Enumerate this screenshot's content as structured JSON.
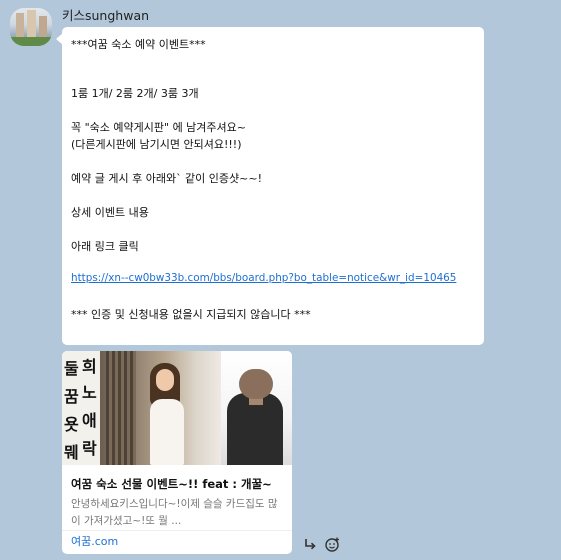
{
  "message": {
    "sender": "키스sunghwan",
    "lines": [
      "***여꿈 숙소 예약 이벤트***",
      "1룸 1개/ 2룸 2개/ 3룸 3개",
      "꼭  \"숙소 예약게시판\" 에 남겨주셔요~",
      "(다른게시판에 남기시면 안되셔요!!!)",
      "예약 글 게시 후 아래와` 같이 인증샷~~!",
      "상세 이벤트 내용",
      "아래 링크 클릭",
      "https://xn--cw0bw33b.com/bbs/board.php?bo_table=notice&wr_id=10465",
      "*** 인증 및 신청내용 없을시 지급되지 않습니다 ***"
    ]
  },
  "link_preview": {
    "calligraphy_left": [
      "둘",
      "꿈",
      "욧",
      "뭬"
    ],
    "calligraphy_right": [
      "희",
      "노",
      "애",
      "락"
    ],
    "title": "여꿈 숙소 선물 이벤트~!! feat : 개꿀~",
    "description": "안녕하세요키스입니다~!이제 슬슬 카드집도 많이 가져가셨고~!또 뭘 ...",
    "domain": "여꿈.com"
  },
  "icons": {
    "share": "share-arrow-icon",
    "emoji": "emoji-add-icon"
  }
}
